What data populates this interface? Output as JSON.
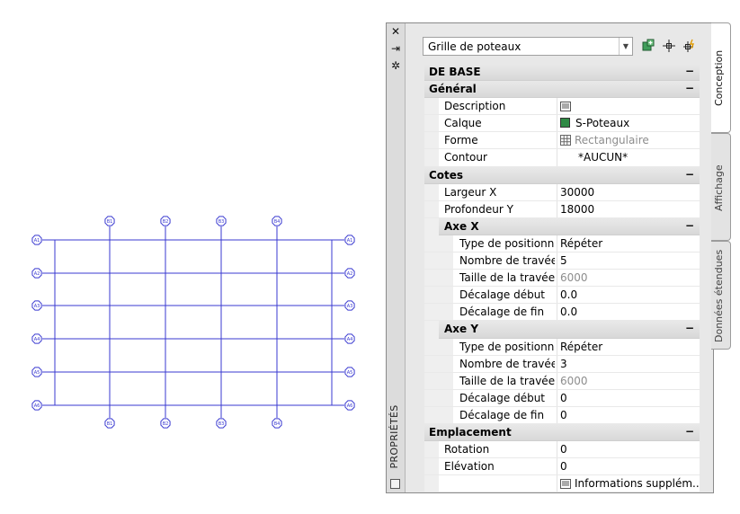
{
  "drawing": {
    "top_labels": [
      "B1",
      "B2",
      "B3",
      "B4"
    ],
    "bottom_labels": [
      "B1",
      "B2",
      "B3",
      "B4"
    ],
    "left_labels": [
      "A1",
      "A2",
      "A3",
      "A4",
      "A5",
      "A6"
    ],
    "right_labels": [
      "A1",
      "A2",
      "A3",
      "A4",
      "A5",
      "A6"
    ],
    "line_color": "#3a3ad0"
  },
  "palette": {
    "vertical_title": "PROPRIÉTÉS",
    "selector_value": "Grille de poteaux",
    "tools": [
      "add-style-icon",
      "pick-point-icon",
      "quick-select-icon"
    ],
    "sections": {
      "base": "DE BASE",
      "general": "Général",
      "cotes": "Cotes",
      "axe_x": "Axe X",
      "axe_y": "Axe Y",
      "emplacement": "Emplacement"
    },
    "toggle": "−",
    "general_rows": [
      {
        "label": "Description",
        "value": ""
      },
      {
        "label": "Calque",
        "value": "S-Poteaux"
      },
      {
        "label": "Forme",
        "value": "Rectangulaire"
      },
      {
        "label": "Contour",
        "value": "*AUCUN*"
      }
    ],
    "cotes_rows": [
      {
        "label": "Largeur X",
        "value": "30000"
      },
      {
        "label": "Profondeur Y",
        "value": "18000"
      }
    ],
    "axe_x_rows": [
      {
        "label": "Type de positionn...",
        "value": "Répéter"
      },
      {
        "label": "Nombre de travées",
        "value": "5"
      },
      {
        "label": "Taille de la travée",
        "value": "6000"
      },
      {
        "label": "Décalage début",
        "value": "0.0"
      },
      {
        "label": "Décalage de fin",
        "value": "0.0"
      }
    ],
    "axe_y_rows": [
      {
        "label": "Type de positionn...",
        "value": "Répéter"
      },
      {
        "label": "Nombre de travées",
        "value": "3"
      },
      {
        "label": "Taille de la travée",
        "value": "6000"
      },
      {
        "label": "Décalage début",
        "value": "0"
      },
      {
        "label": "Décalage de fin",
        "value": "0"
      }
    ],
    "emplacement_rows": [
      {
        "label": "Rotation",
        "value": "0"
      },
      {
        "label": "Elévation",
        "value": "0"
      },
      {
        "label": "",
        "value": "Informations  supplém..."
      }
    ],
    "layer_color": "#2f8a45",
    "tabs": [
      "Conception",
      "Affichage",
      "Données étendues"
    ]
  }
}
